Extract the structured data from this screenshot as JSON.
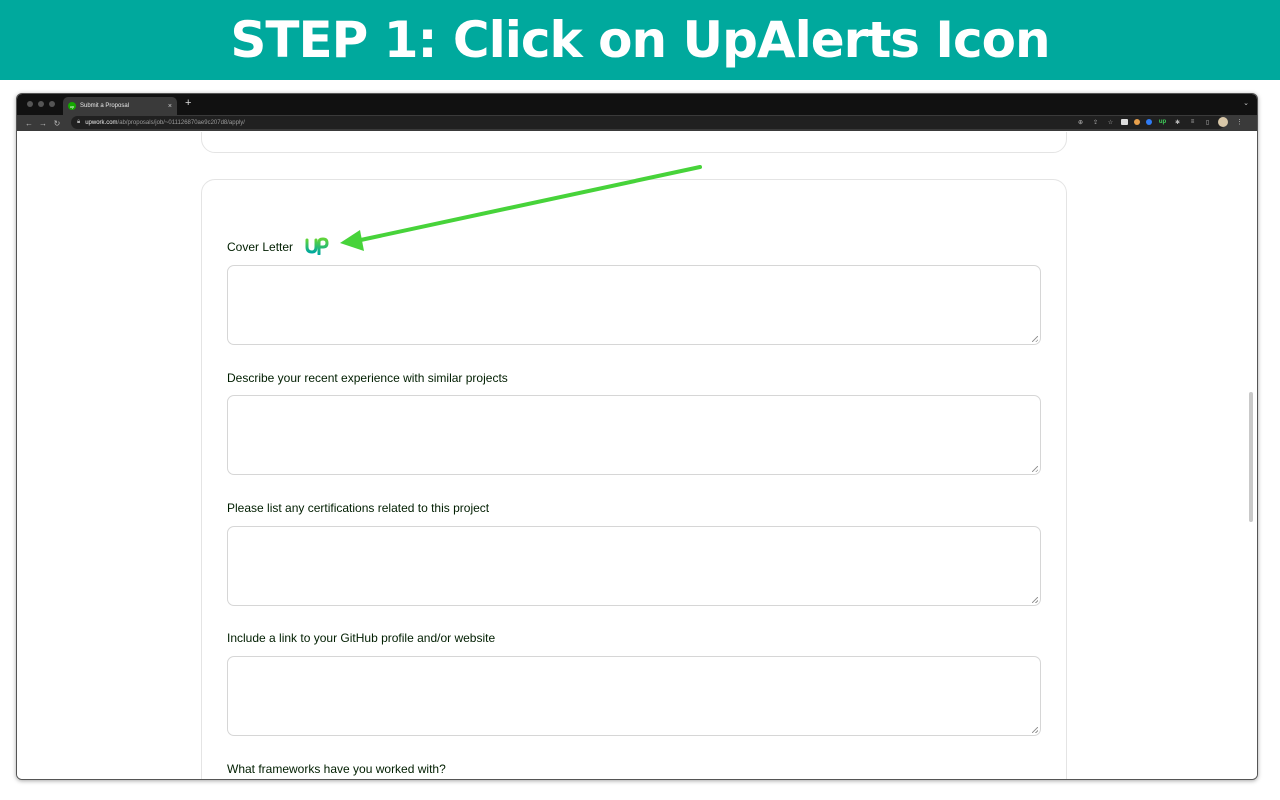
{
  "banner": {
    "title": "STEP 1: Click on UpAlerts Icon"
  },
  "browser": {
    "tab_title": "Submit a Proposal",
    "tab_close": "×",
    "new_tab": "+",
    "favicon_text": "up",
    "url_host": "upwork.com",
    "url_path": "/ab/proposals/job/~011126870ae9c207d8/apply/",
    "nav_icons": [
      "back-arrow-icon",
      "forward-arrow-icon",
      "reload-icon"
    ],
    "extension_icons": [
      "zoom-icon",
      "share-icon",
      "bookmark-star-icon",
      "extension-1-icon",
      "extension-2-icon",
      "extension-3-icon",
      "upalerts-extension-icon",
      "puzzle-icon",
      "reading-list-icon",
      "side-panel-icon",
      "profile-avatar-icon",
      "menu-kebab-icon"
    ]
  },
  "form": {
    "cover_letter_label": "Cover Letter",
    "cover_letter_value": "",
    "questions": [
      {
        "label": "Describe your recent experience with similar projects",
        "value": ""
      },
      {
        "label": "Please list any certifications related to this project",
        "value": ""
      },
      {
        "label": "Include a link to your GitHub profile and/or website",
        "value": ""
      },
      {
        "label": "What frameworks have you worked with?",
        "value": ""
      }
    ]
  },
  "colors": {
    "banner_bg": "#00a99d",
    "arrow_green": "#47d33a",
    "upalerts_icon_top": "#5fd33a",
    "upalerts_icon_bottom": "#00a99d",
    "label_text": "#001e00"
  }
}
